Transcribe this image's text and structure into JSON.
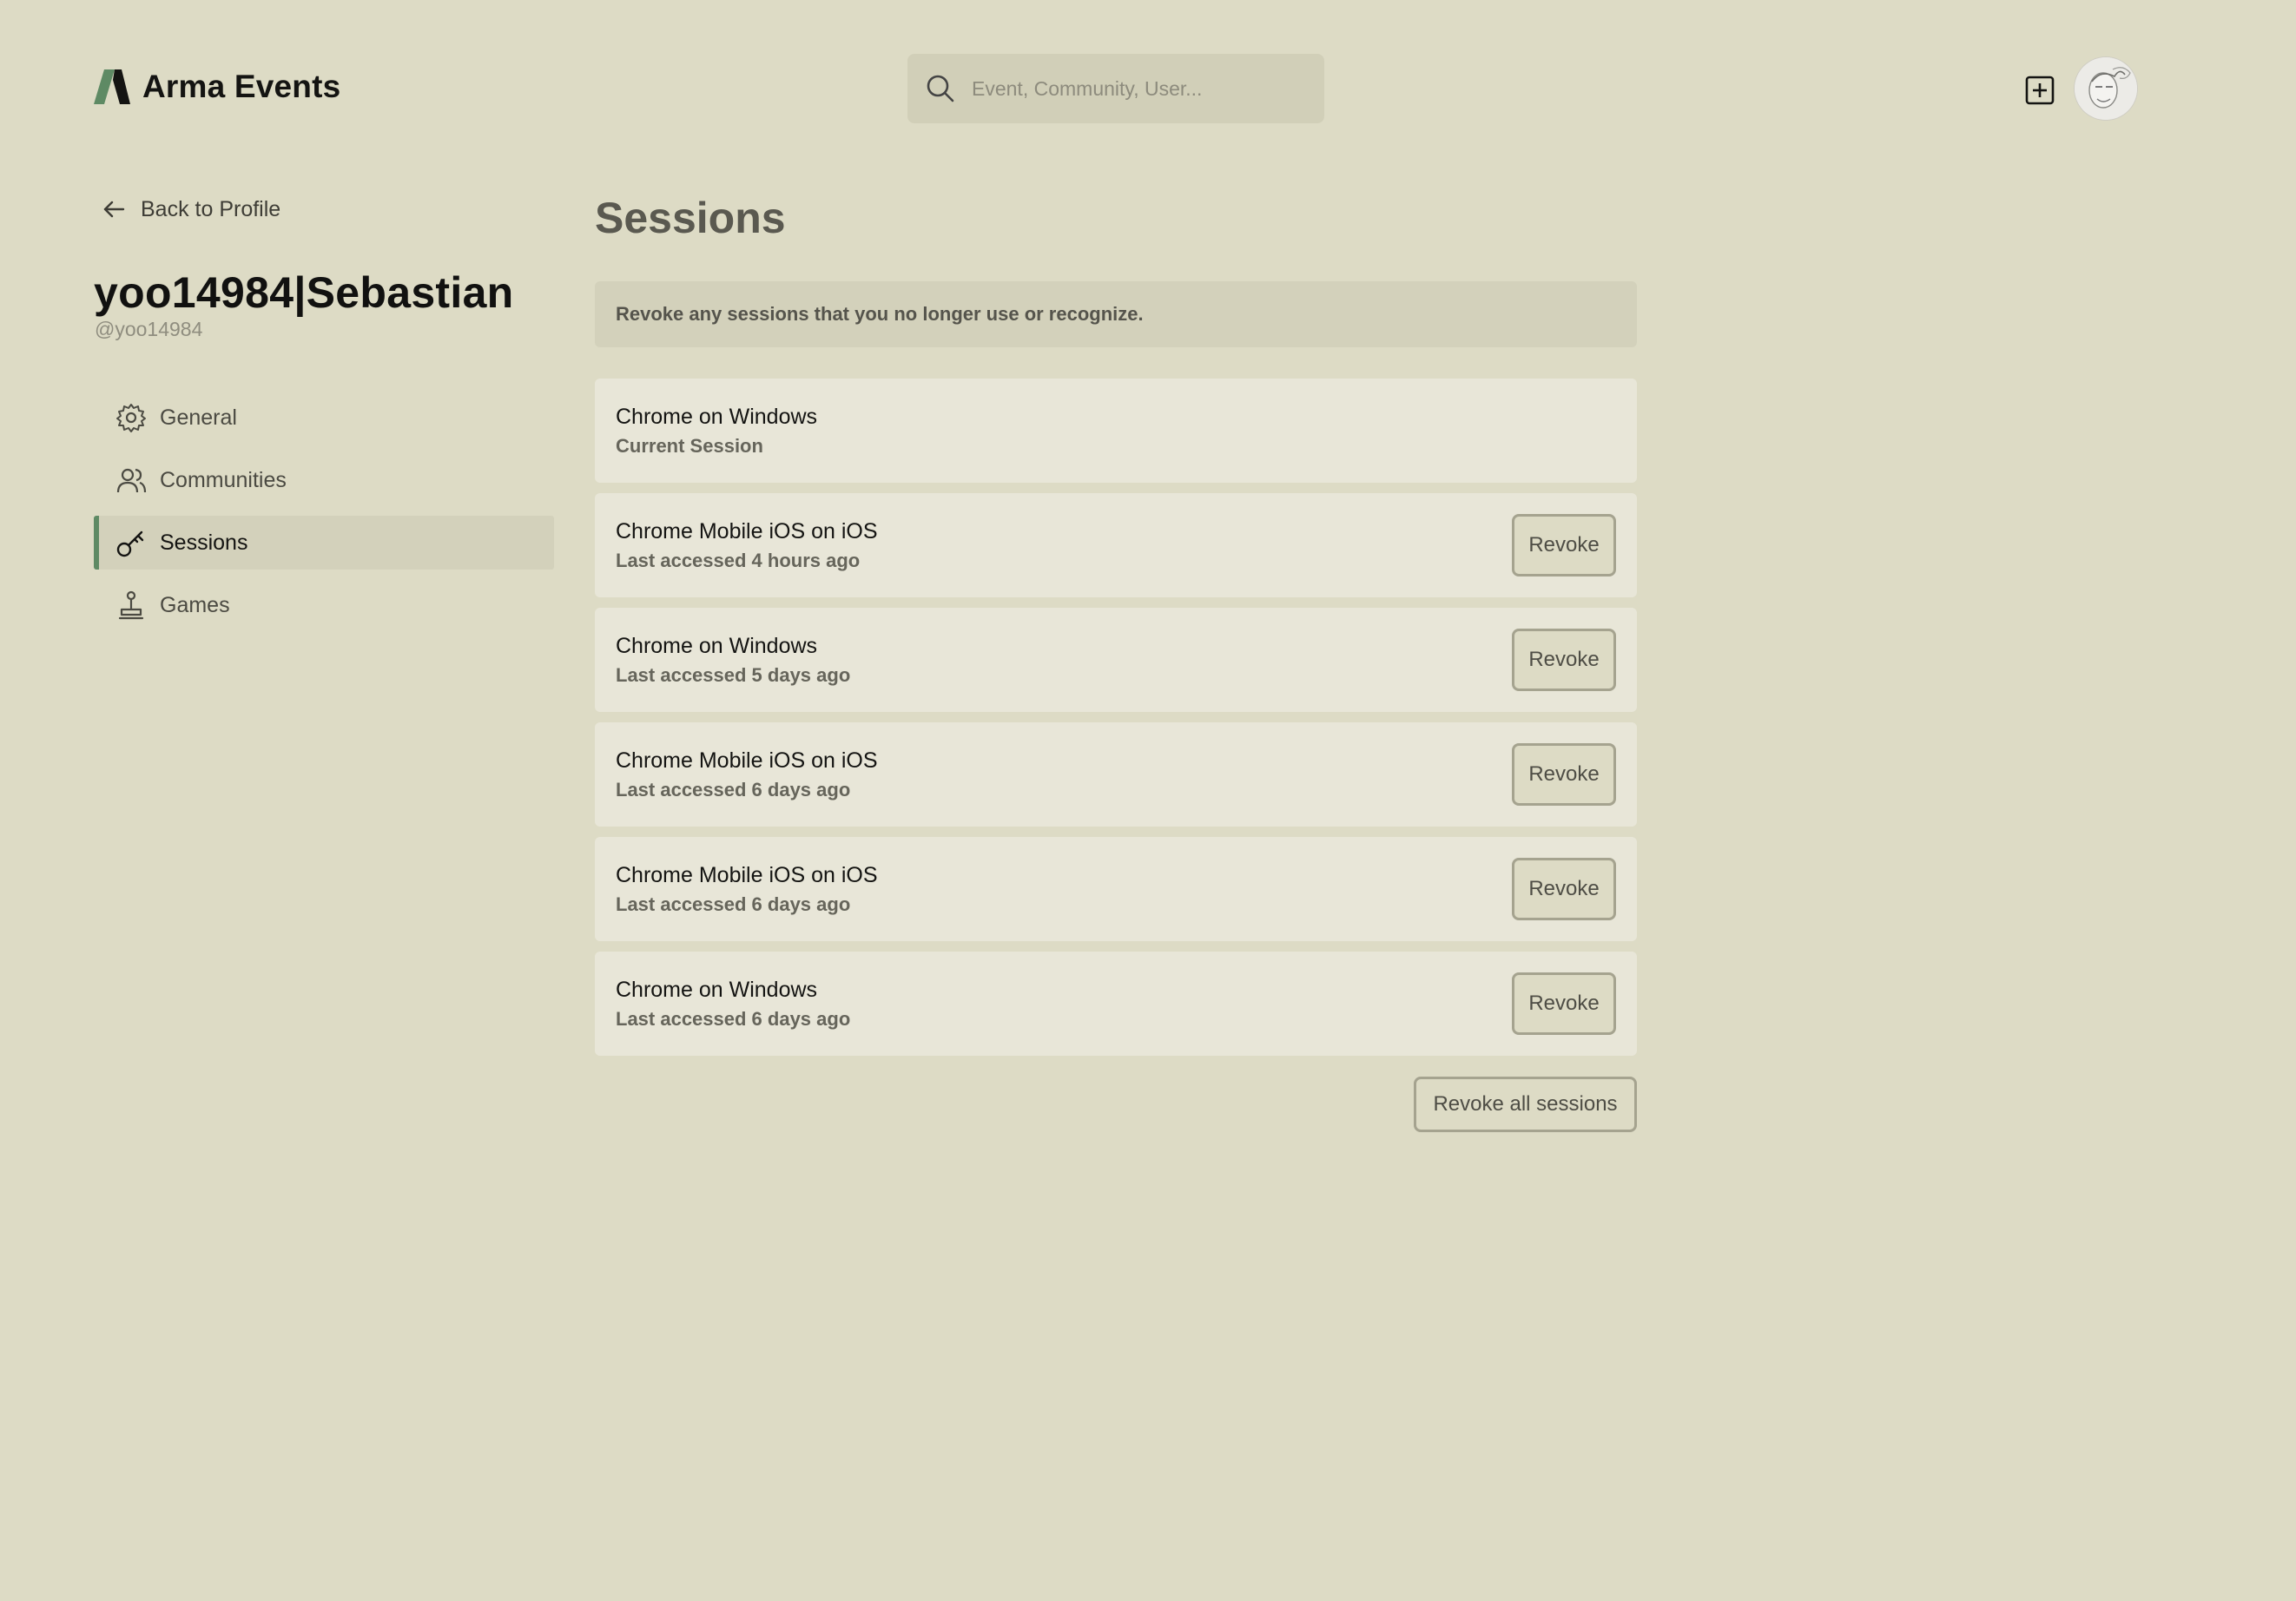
{
  "app": {
    "name": "Arma Events",
    "brand_color": "#5e8a64"
  },
  "header": {
    "search_placeholder": "Event, Community, User...",
    "search_icon": "search-icon",
    "create_icon": "plus-square-icon",
    "avatar_icon": "user-avatar"
  },
  "sidebar": {
    "back_label": "Back to Profile",
    "profile_name": "yoo14984|Sebastian",
    "profile_handle": "@yoo14984",
    "items": [
      {
        "label": "General",
        "icon": "gear-icon",
        "active": false
      },
      {
        "label": "Communities",
        "icon": "users-icon",
        "active": false
      },
      {
        "label": "Sessions",
        "icon": "key-icon",
        "active": true
      },
      {
        "label": "Games",
        "icon": "joystick-icon",
        "active": false
      }
    ]
  },
  "main": {
    "title": "Sessions",
    "info": "Revoke any sessions that you no longer use or recognize.",
    "sessions": [
      {
        "device": "Chrome on Windows",
        "meta": "Current Session"
      },
      {
        "device": "Chrome Mobile iOS on iOS",
        "meta": "Last accessed 4 hours ago",
        "action": "Revoke"
      },
      {
        "device": "Chrome on Windows",
        "meta": "Last accessed 5 days ago",
        "action": "Revoke"
      },
      {
        "device": "Chrome Mobile iOS on iOS",
        "meta": "Last accessed 6 days ago",
        "action": "Revoke"
      },
      {
        "device": "Chrome Mobile iOS on iOS",
        "meta": "Last accessed 6 days ago",
        "action": "Revoke"
      },
      {
        "device": "Chrome on Windows",
        "meta": "Last accessed 6 days ago",
        "action": "Revoke"
      }
    ],
    "revoke_all_label": "Revoke all sessions"
  }
}
